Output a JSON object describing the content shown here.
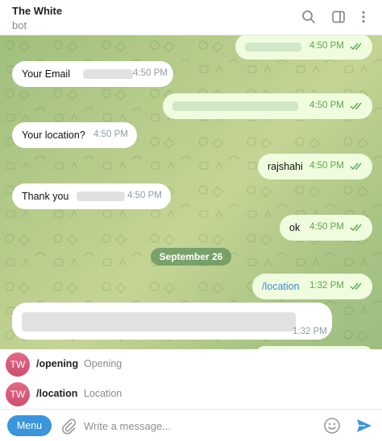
{
  "header": {
    "title": "The White",
    "subtitle": "bot",
    "icons": [
      "search-icon",
      "sidebar-toggle-icon",
      "more-icon"
    ]
  },
  "messages": [
    {
      "direction": "out",
      "text": "",
      "time": "4:50 PM",
      "status": "read"
    },
    {
      "direction": "in",
      "text": "Your Email",
      "time": "4:50 PM"
    },
    {
      "direction": "out",
      "text": "",
      "time": "4:50 PM",
      "status": "read"
    },
    {
      "direction": "in",
      "text": "Your location?",
      "time": "4:50 PM"
    },
    {
      "direction": "out",
      "text": "rajshahi",
      "time": "4:50 PM",
      "status": "read"
    },
    {
      "direction": "in",
      "text": "Thank you",
      "time": "4:50 PM"
    },
    {
      "direction": "out",
      "text": "ok",
      "time": "4:50 PM",
      "status": "read"
    },
    {
      "direction": "out",
      "text": "/location",
      "time": "1:32 PM",
      "status": "read"
    },
    {
      "direction": "in",
      "text": "",
      "time": "1:32 PM"
    }
  ],
  "date_separator": "September 26",
  "commands": [
    {
      "avatar": "TW",
      "name": "/opening",
      "description": "Opening"
    },
    {
      "avatar": "TW",
      "name": "/location",
      "description": "Location"
    }
  ],
  "input": {
    "menu_label": "Menu",
    "placeholder": "Write a message...",
    "icons": [
      "attach-icon",
      "emoji-icon",
      "send-icon"
    ]
  },
  "colors": {
    "accent": "#3a95dd",
    "outgoing_bubble": "#effdde",
    "incoming_bubble": "#ffffff",
    "read_check": "#59a64d",
    "avatar": "#d95674"
  }
}
